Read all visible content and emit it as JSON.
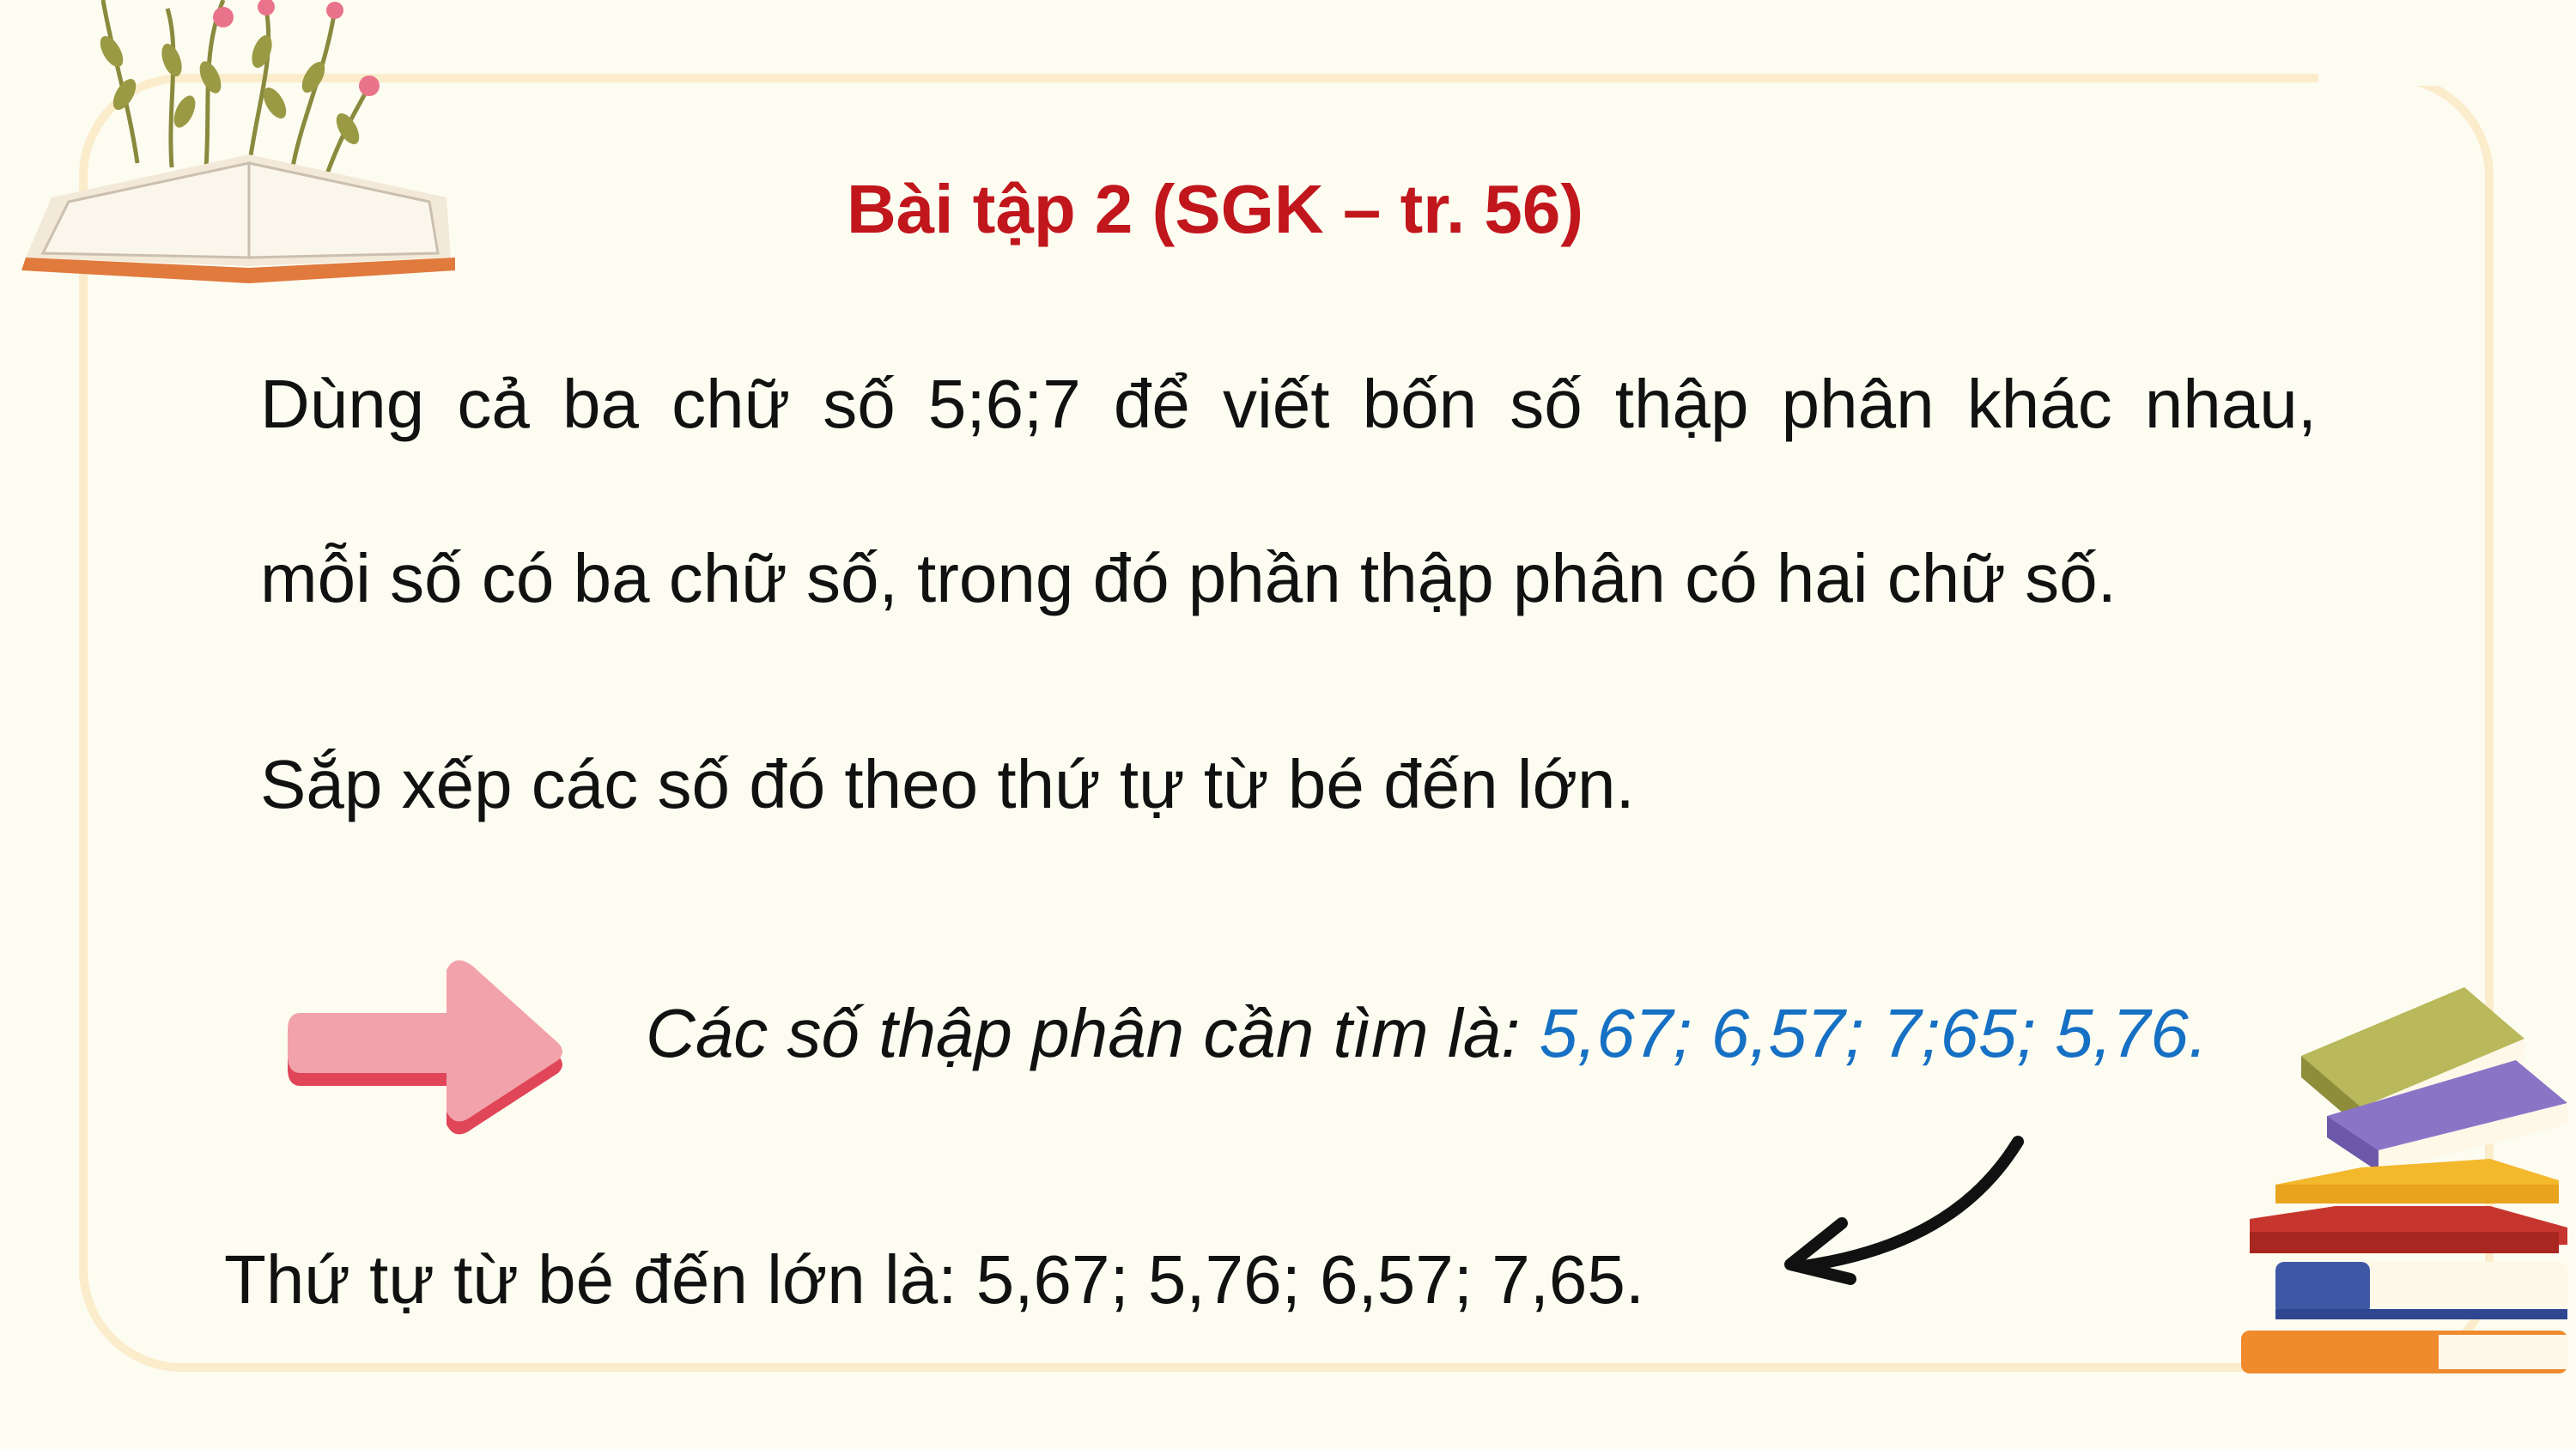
{
  "title": "Bài tập 2 (SGK – tr. 56)",
  "problem": {
    "line1": "Dùng cả ba chữ số 5;6;7 để viết bốn số thập phân khác nhau,",
    "line2": "mỗi số có ba chữ số, trong đó phần thập phân có hai chữ số.",
    "line3": "Sắp xếp các số đó theo thứ tự từ bé đến lớn."
  },
  "answer": {
    "label": "Các số thập phân cần tìm là: ",
    "values": "5,67; 6,57; 7;65; 5,76."
  },
  "order": {
    "text": "Thứ tự từ bé đến lớn là: 5,67; 5,76; 6,57; 7,65."
  },
  "colors": {
    "title": "#c0161c",
    "answer_values": "#1670c4",
    "frame": "#fbeccb",
    "arrow": "#f2a2aa"
  },
  "icons": {
    "top_left": "open-book-with-flowers-icon",
    "right_arrow": "pink-right-arrow-icon",
    "curved_arrow": "curved-arrow-icon",
    "bottom_right": "stack-of-books-icon"
  }
}
